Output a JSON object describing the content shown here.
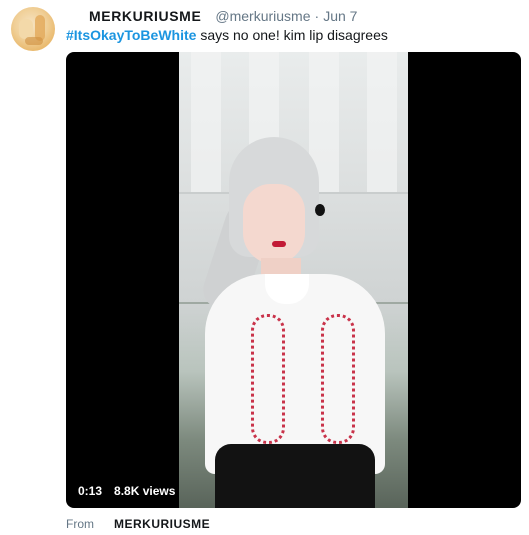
{
  "tweet": {
    "display_name": "MERKURIUSME",
    "handle": "@merkuriusme",
    "separator": "·",
    "date": "Jun 7",
    "hashtag": "#ItsOkayToBeWhite",
    "text_rest": " says no one! kim lip disagrees",
    "avatar_icon": "profile-avatar"
  },
  "video": {
    "time": "0:13",
    "views": "8.8K views"
  },
  "footer": {
    "from_label": "From",
    "source_name": "MERKURIUSME"
  },
  "colors": {
    "hashtag": "#1b95e0",
    "muted": "#657786",
    "text": "#14171a",
    "embroidery": "#c9334a"
  }
}
